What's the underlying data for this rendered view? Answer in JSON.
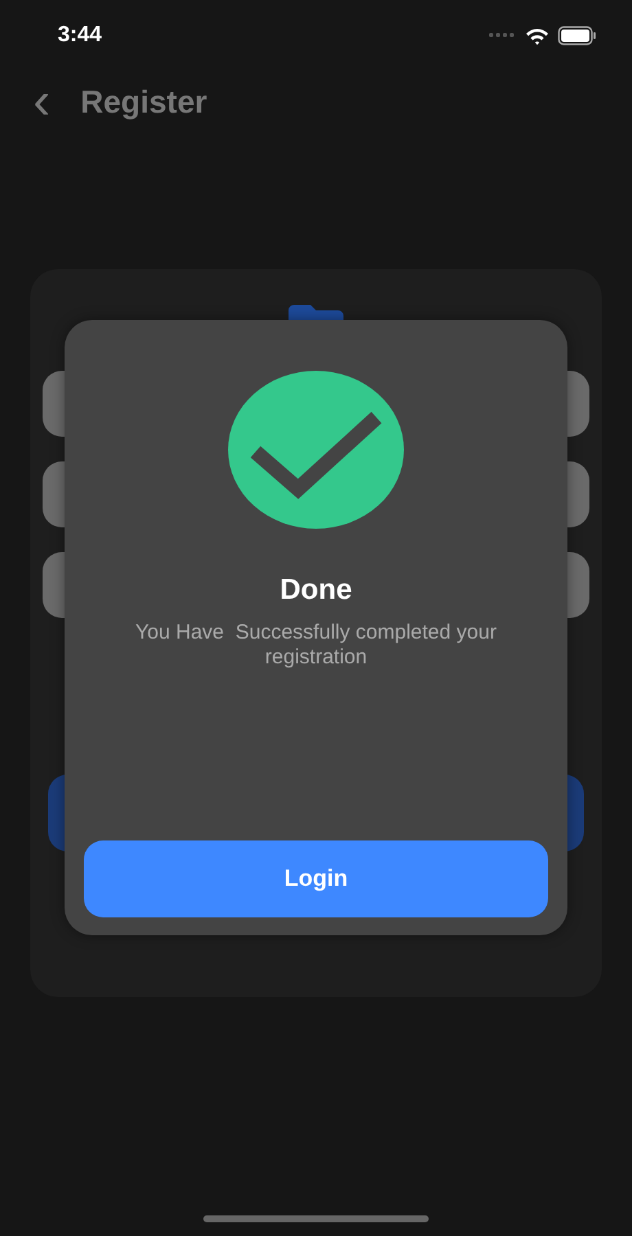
{
  "status_bar": {
    "time": "3:44"
  },
  "header": {
    "back": "‹",
    "title": "Register"
  },
  "dialog": {
    "title": "Done",
    "message": "You Have  Successfully completed your registration",
    "button": "Login"
  }
}
